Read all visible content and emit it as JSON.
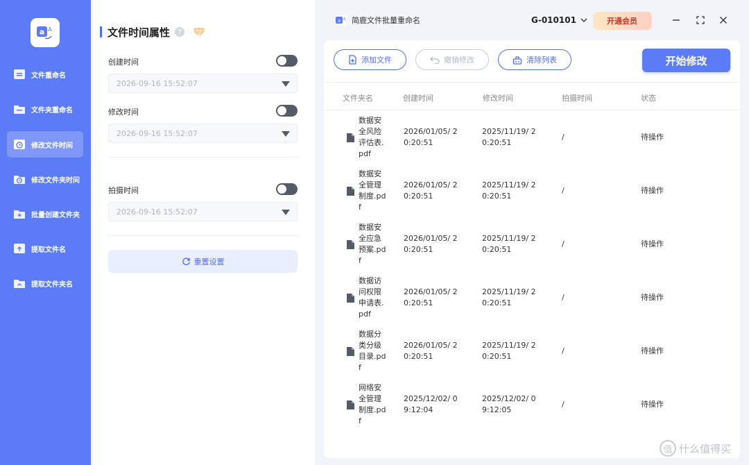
{
  "sidebar": {
    "items": [
      {
        "label": "文件重命名",
        "icon": "file-rename-icon",
        "active": false
      },
      {
        "label": "文件夹重命名",
        "icon": "folder-rename-icon",
        "active": false
      },
      {
        "label": "修改文件时间",
        "icon": "file-time-icon",
        "active": true
      },
      {
        "label": "修改文件夹时间",
        "icon": "folder-time-icon",
        "active": false
      },
      {
        "label": "批量创建文件夹",
        "icon": "folder-create-icon",
        "active": false
      },
      {
        "label": "提取文件名",
        "icon": "extract-filename-icon",
        "active": false
      },
      {
        "label": "提取文件夹名",
        "icon": "extract-foldername-icon",
        "active": false
      }
    ]
  },
  "panel": {
    "title": "文件时间属性",
    "help_icon": "?",
    "created": {
      "label": "创建时间",
      "value": "2026-09-16 15:52:07",
      "enabled": false
    },
    "modified": {
      "label": "修改时间",
      "value": "2026-09-16 15:52:07",
      "enabled": false
    },
    "shot": {
      "label": "拍摄时间",
      "value": "2026-09-16 15:52:07",
      "enabled": false
    },
    "reset_label": "重置设置"
  },
  "topbar": {
    "app_title": "简鹿文件批量重命名",
    "account": "G-010101",
    "vip_label": "开通会员"
  },
  "toolbar": {
    "add_label": "添加文件",
    "undo_label": "撤销修改",
    "clear_label": "清除列表",
    "start_label": "开始修改"
  },
  "table": {
    "headers": [
      "文件夹名",
      "创建时间",
      "修改时间",
      "拍摄时间",
      "状态"
    ],
    "rows": [
      {
        "name": "数据安全风险评估表.pdf",
        "created": "2026/01/05/ 20:20:51",
        "modified": "2025/11/19/ 20:20:51",
        "shot": "/",
        "status": "待操作"
      },
      {
        "name": "数据安全管理制度.pdf",
        "created": "2026/01/05/ 20:20:51",
        "modified": "2025/11/19/ 20:20:51",
        "shot": "/",
        "status": "待操作"
      },
      {
        "name": "数据安全应急预案.pdf",
        "created": "2026/01/05/ 20:20:51",
        "modified": "2025/11/19/ 20:20:51",
        "shot": "/",
        "status": "待操作"
      },
      {
        "name": "数据访问权限申请表.pdf",
        "created": "2026/01/05/ 20:20:51",
        "modified": "2025/11/19/ 20:20:51",
        "shot": "/",
        "status": "待操作"
      },
      {
        "name": "数据分类分级目录.pdf",
        "created": "2026/01/05/ 20:20:51",
        "modified": "2025/11/19/ 20:20:51",
        "shot": "/",
        "status": "待操作"
      },
      {
        "name": "网络安全管理制度.pdf",
        "created": "2025/12/02/ 09:12:04",
        "modified": "2025/12/02/ 09:12:05",
        "shot": "/",
        "status": "待操作"
      }
    ]
  },
  "watermark": {
    "badge": "值",
    "text": "什么值得买"
  },
  "colors": {
    "accent": "#5b7cf6",
    "sidebar": "#5b7cf6",
    "vip_text": "#c0392b"
  }
}
